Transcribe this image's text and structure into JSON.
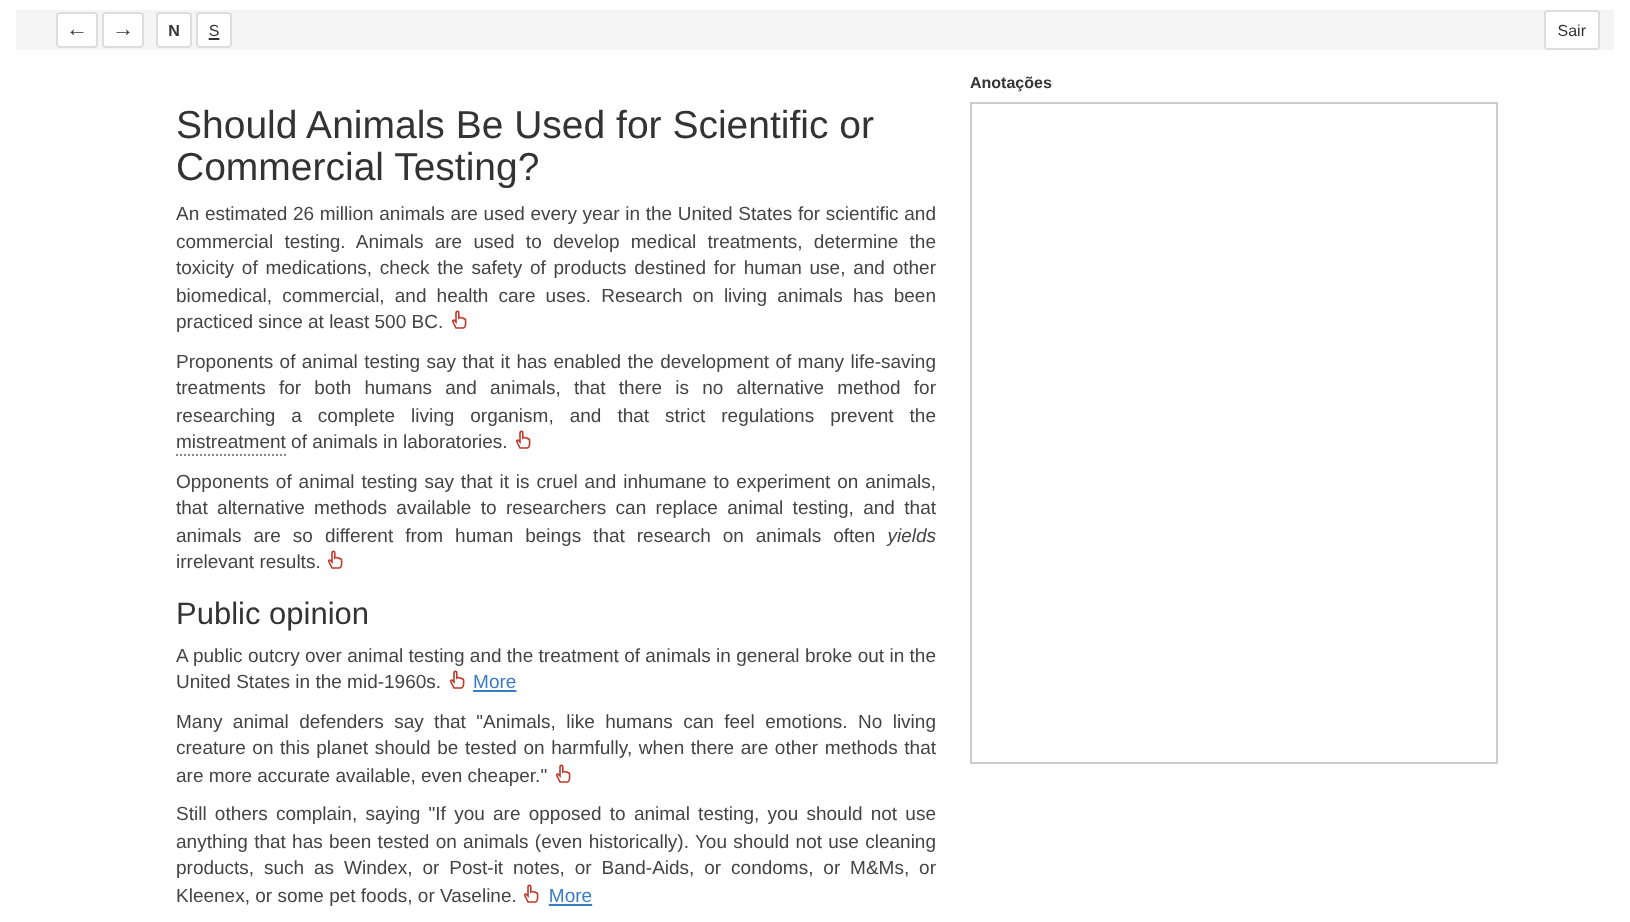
{
  "toolbar": {
    "buttons": [
      {
        "label": "←",
        "kind": "plain"
      },
      {
        "label": "→",
        "kind": "plain"
      },
      {
        "label": "N",
        "kind": "bold"
      },
      {
        "label": "S",
        "kind": "underline"
      }
    ],
    "exit": "Sair"
  },
  "article": {
    "title": "Should Animals Be Used for Scientific or Commercial Testing?",
    "sections": [
      {
        "paragraphs": [
          {
            "segments": [
              {
                "kind": "text",
                "text": "An estimated 26 million animals are used every year in the United States for scientific and commercial testing. Animals are used to develop medical treatments, determine the toxicity of medications, check the safety of products destined for human use, and other biomedical, commercial, and health care uses. Research on living animals has been practiced since at least 500 BC."
              }
            ]
          },
          {
            "segments": [
              {
                "kind": "text",
                "text": "Proponents of animal testing say that it has enabled the development of many life-saving treatments for both humans and animals, that there is no alternative method for researching a complete living organism, and that strict regulations prevent the "
              },
              {
                "kind": "term",
                "text": "mistreatment"
              },
              {
                "kind": "text",
                "text": " of animals in laboratories."
              }
            ]
          },
          {
            "segments": [
              {
                "kind": "text",
                "text": "Opponents of animal testing say that it is cruel and inhumane to experiment on animals, that alternative methods available to researchers can replace animal testing, and that animals are so different from human beings that research on animals often *yields* irrelevant results."
              }
            ]
          }
        ]
      },
      {
        "heading": "Public opinion",
        "paragraphs": [
          {
            "segments": [
              {
                "kind": "text",
                "text": "A public outcry over animal testing and the treatment of animals in general broke out in the United States in the mid-1960s."
              }
            ],
            "more": "More"
          },
          {
            "segments": [
              {
                "kind": "text",
                "text": "Many animal defenders say that \"Animals, like humans can feel emotions. No living creature on this planet should be tested on harmfully, when there are other methods that are more accurate available, even cheaper.\""
              }
            ]
          },
          {
            "segments": [
              {
                "kind": "text",
                "text": "Still others complain, saying \"If you are opposed to animal testing, you should not use anything that has been tested on animals (even historically). You should not use cleaning products, such as Windex, or Post-it notes, or Band-Aids, or condoms, or M&Ms, or Kleenex, or some pet foods, or Vaseline."
              }
            ],
            "more": "More"
          }
        ]
      }
    ]
  },
  "notes": {
    "label": "Anotações"
  }
}
